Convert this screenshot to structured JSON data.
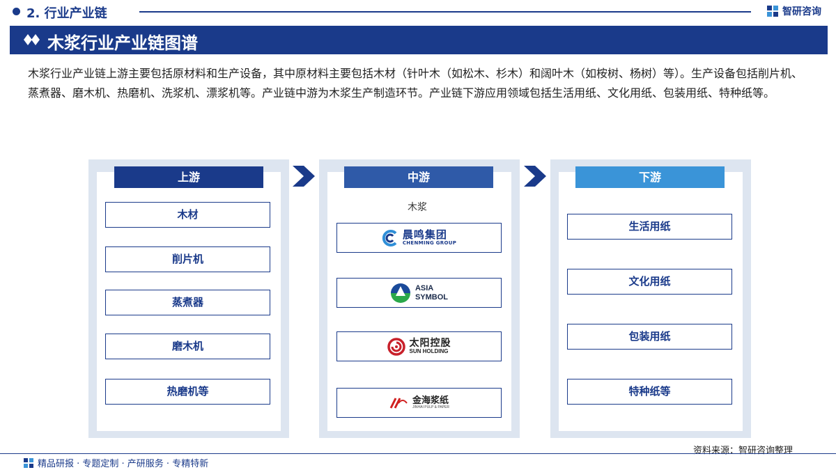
{
  "header": {
    "section_title": "2. 行业产业链",
    "brand_name": "智研咨询"
  },
  "banner": {
    "title": "木浆行业产业链图谱"
  },
  "intro": {
    "text": "木浆行业产业链上游主要包括原材料和生产设备，其中原材料主要包括木材（针叶木（如松木、杉木）和阔叶木（如桉树、杨树）等）。生产设备包括削片机、蒸煮器、磨木机、热磨机、洗浆机、漂浆机等。产业链中游为木浆生产制造环节。产业链下游应用领域包括生活用纸、文化用纸、包装用纸、特种纸等。"
  },
  "upstream": {
    "header": "上游",
    "items": [
      "木材",
      "削片机",
      "蒸煮器",
      "磨木机",
      "热磨机等"
    ]
  },
  "midstream": {
    "header": "中游",
    "label": "木浆",
    "companies": [
      {
        "cn": "晨鸣集团",
        "en": "CHENMING GROUP"
      },
      {
        "en1": "ASIA",
        "en2": "SYMBOL"
      },
      {
        "cn": "太阳控股",
        "en": "SUN HOLDING"
      },
      {
        "cn": "金海浆纸",
        "en": "JINHAI PULP & PAPER"
      }
    ]
  },
  "downstream": {
    "header": "下游",
    "items": [
      "生活用纸",
      "文化用纸",
      "包装用纸",
      "特种纸等"
    ]
  },
  "source": "资料来源：智研咨询整理",
  "footer": {
    "text": "精品研报 · 专题定制 · 产研服务 · 专精特新"
  },
  "colors": {
    "navy": "#1a3a8a",
    "mid_blue": "#2f5aa8",
    "light_blue": "#3a94d8",
    "panel_bg": "#dde5f0"
  }
}
